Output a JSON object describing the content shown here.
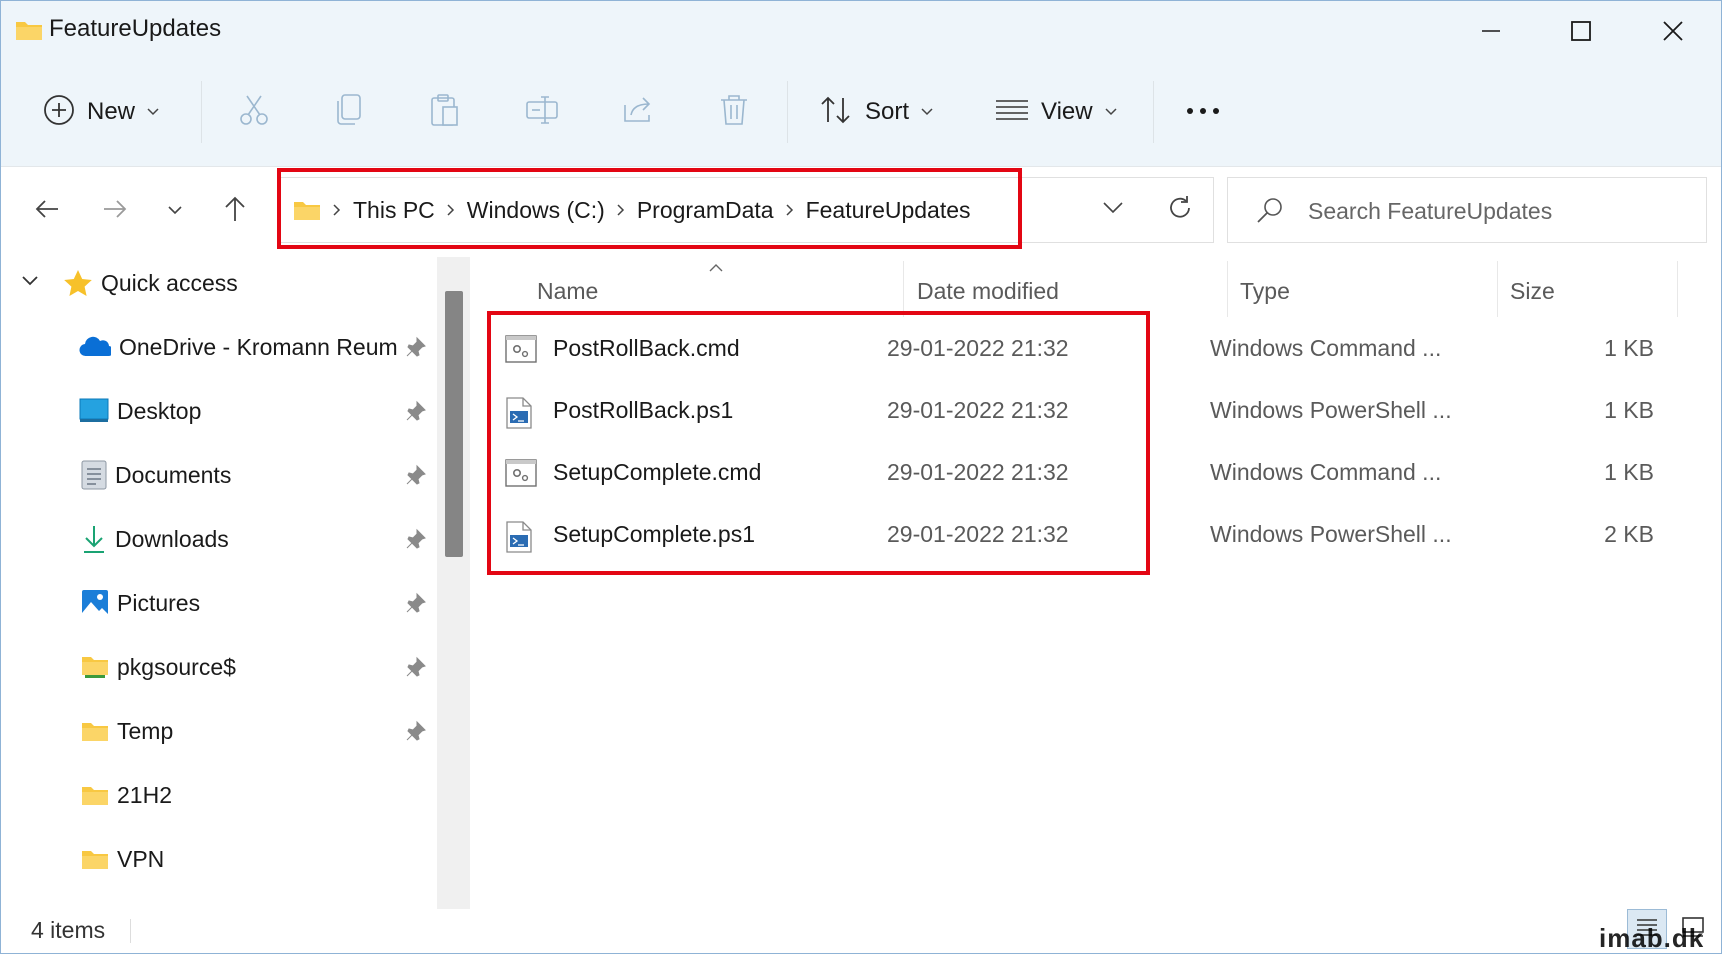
{
  "window": {
    "title": "FeatureUpdates"
  },
  "toolbar": {
    "new_label": "New",
    "sort_label": "Sort",
    "view_label": "View",
    "icons": [
      "plus-circle-icon",
      "cut-icon",
      "copy-icon",
      "paste-icon",
      "rename-icon",
      "share-icon",
      "delete-icon",
      "sort-icon",
      "view-icon",
      "more-icon"
    ]
  },
  "address": {
    "crumbs": [
      "This PC",
      "Windows (C:)",
      "ProgramData",
      "FeatureUpdates"
    ]
  },
  "search": {
    "placeholder": "Search FeatureUpdates"
  },
  "sidebar": {
    "items": [
      {
        "label": "Quick access",
        "icon": "star-icon"
      },
      {
        "label": "OneDrive - Kromann Reum",
        "icon": "onedrive-icon",
        "pinned": true
      },
      {
        "label": "Desktop",
        "icon": "desktop-icon",
        "pinned": true
      },
      {
        "label": "Documents",
        "icon": "documents-icon",
        "pinned": true
      },
      {
        "label": "Downloads",
        "icon": "downloads-icon",
        "pinned": true
      },
      {
        "label": "Pictures",
        "icon": "pictures-icon",
        "pinned": true
      },
      {
        "label": "pkgsource$",
        "icon": "network-folder-icon",
        "pinned": true
      },
      {
        "label": "Temp",
        "icon": "folder-icon",
        "pinned": true
      },
      {
        "label": "21H2",
        "icon": "folder-icon",
        "pinned": false
      },
      {
        "label": "VPN",
        "icon": "folder-icon",
        "pinned": false
      }
    ]
  },
  "columns": {
    "name": "Name",
    "date": "Date modified",
    "type": "Type",
    "size": "Size"
  },
  "files": [
    {
      "name": "PostRollBack.cmd",
      "date": "29-01-2022 21:32",
      "type": "Windows Command ...",
      "size": "1 KB",
      "icon": "cmd-file-icon"
    },
    {
      "name": "PostRollBack.ps1",
      "date": "29-01-2022 21:32",
      "type": "Windows PowerShell ...",
      "size": "1 KB",
      "icon": "powershell-file-icon"
    },
    {
      "name": "SetupComplete.cmd",
      "date": "29-01-2022 21:32",
      "type": "Windows Command ...",
      "size": "1 KB",
      "icon": "cmd-file-icon"
    },
    {
      "name": "SetupComplete.ps1",
      "date": "29-01-2022 21:32",
      "type": "Windows PowerShell ...",
      "size": "2 KB",
      "icon": "powershell-file-icon"
    }
  ],
  "status": {
    "item_count": "4 items"
  },
  "watermark": "imab.dk",
  "colors": {
    "highlight": "#e30613",
    "chrome": "#eef5fa",
    "folder": "#f8c842",
    "accent": "#0067c0"
  }
}
